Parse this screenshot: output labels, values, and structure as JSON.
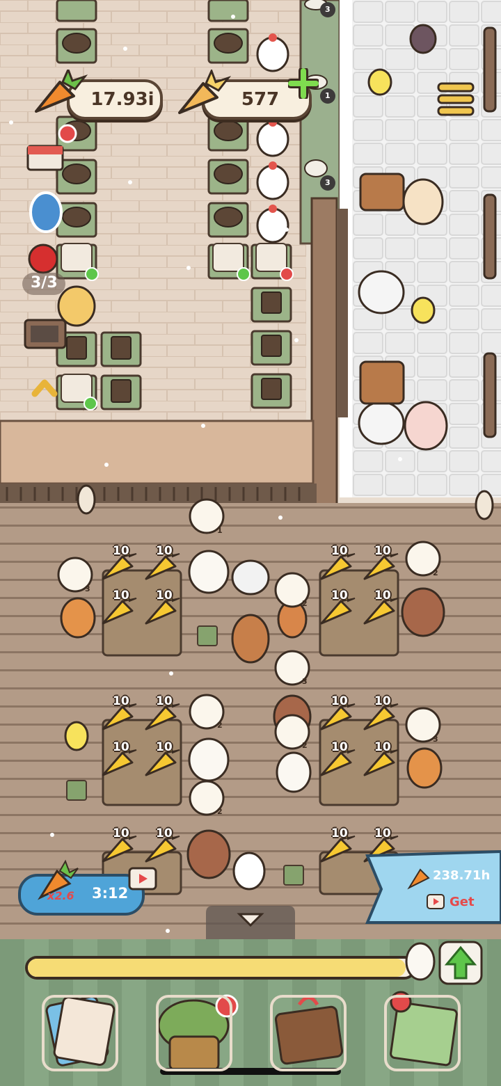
{
  "hud": {
    "carrot_count": "17.93i",
    "golden_carrot_count": "577",
    "plus_icon": "plus-icon",
    "menu_icon": "hamburger-menu-icon",
    "apple_counter": "3/3"
  },
  "scene": {
    "stack_counts": [
      "3",
      "1",
      "3"
    ],
    "order_bubble_counts": [
      "1",
      "3",
      "2",
      "2",
      "3",
      "2",
      "2",
      "2",
      "3",
      "2"
    ],
    "carrot_value": "10"
  },
  "boost": {
    "multiplier": "x2.6",
    "timer": "3:12"
  },
  "offer": {
    "amount": "238.71h",
    "get_label": "Get"
  },
  "progress": {
    "fraction": 0.98
  },
  "nav": {
    "items": [
      {
        "icon": "recipe-cards-icon"
      },
      {
        "icon": "tree-house-icon",
        "alert": true
      },
      {
        "icon": "gift-box-icon"
      },
      {
        "icon": "map-icon"
      }
    ]
  },
  "colors": {
    "progress_fill": "#f6dc75",
    "offer_banner": "#9fd6ef",
    "boost_pill": "#4fa4d8",
    "get_text": "#e5494a",
    "upgrade_arrow": "#5ec64a"
  }
}
